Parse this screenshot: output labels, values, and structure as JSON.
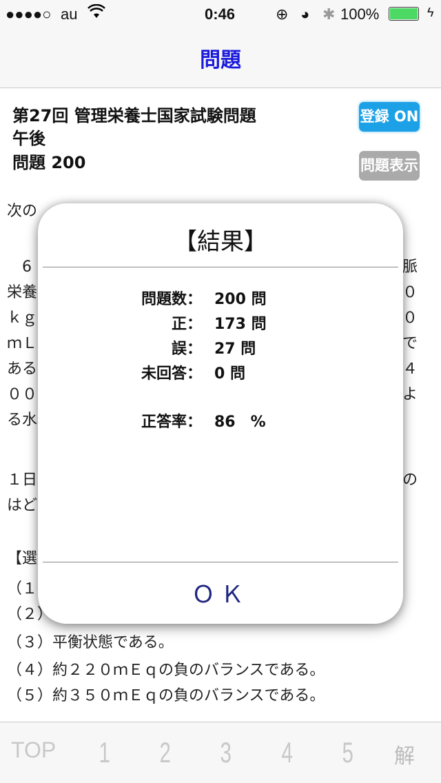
{
  "status_bar": {
    "signal": "●●●●○",
    "carrier": "au",
    "time": "0:46",
    "battery": "100%",
    "icons": [
      "wifi-icon",
      "rotation-lock-icon",
      "alarm-icon",
      "bluetooth-icon",
      "battery-icon",
      "charging-icon"
    ]
  },
  "nav": {
    "title": "問題"
  },
  "header": {
    "line1": "第27回 管理栄養士国家試験問題",
    "line2": "午後",
    "line3": "問題 200",
    "register_button": "登録 ON",
    "show_question_button": "問題表示"
  },
  "background_text": {
    "left": [
      "次の",
      "　6",
      "栄養",
      "ｋｇ",
      "ｍＬ",
      "ある",
      "００",
      "る水",
      "１日",
      "はど",
      "【選",
      "（１",
      "（２）",
      "（３）平衡状態である。",
      "（４）約２２０ｍＥｑの負のバランスである。",
      "（５）約３５０ｍＥｑの負のバランスである。"
    ],
    "right": [
      "脈",
      "０",
      "０",
      "で",
      "４",
      "よ",
      "の"
    ]
  },
  "dialog": {
    "title": "【結果】",
    "rows": [
      {
        "label": "問題数：",
        "value": "200 問"
      },
      {
        "label": "正：",
        "value": "173 問"
      },
      {
        "label": "誤：",
        "value": "27 問"
      },
      {
        "label": "未回答：",
        "value": "0 問"
      },
      {
        "label": "正答率：",
        "value": "86　%"
      }
    ],
    "ok_label": "ＯＫ"
  },
  "tabbar": {
    "items": [
      "TOP",
      "1",
      "2",
      "3",
      "4",
      "5",
      "解"
    ]
  },
  "colors": {
    "nav_title": "#1a1adc",
    "register_button": "#1da1e6",
    "show_button": "#aaaaaa",
    "battery": "#4cd964",
    "ok": "#1f2680"
  }
}
